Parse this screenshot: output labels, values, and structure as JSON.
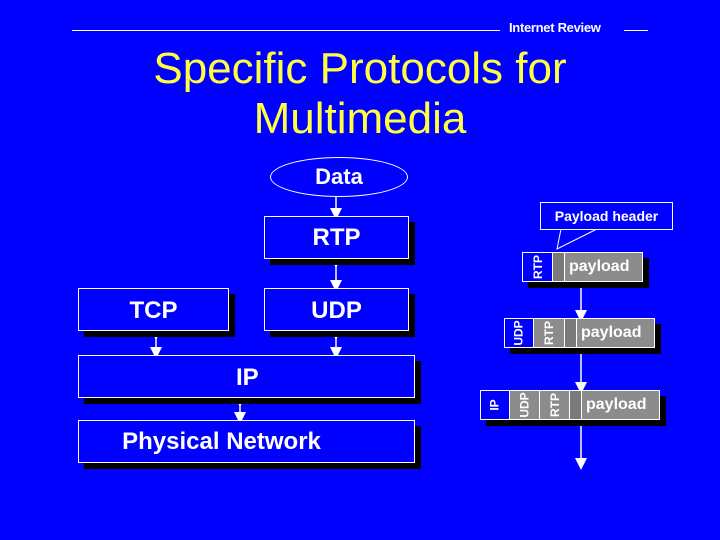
{
  "header": {
    "label": "Internet Review"
  },
  "title": {
    "line1": "Specific Protocols for",
    "line2": "Multimedia"
  },
  "stack": {
    "data": "Data",
    "rtp": "RTP",
    "tcp": "TCP",
    "udp": "UDP",
    "ip": "IP",
    "physical": "Physical Network"
  },
  "encapsulation": {
    "callout": "Payload header",
    "packets": [
      {
        "headers": [
          "RTP"
        ],
        "payload": "payload"
      },
      {
        "headers": [
          "UDP",
          "RTP"
        ],
        "payload": "payload"
      },
      {
        "headers": [
          "IP",
          "UDP",
          "RTP"
        ],
        "payload": "payload"
      }
    ]
  },
  "colors": {
    "background": "#0000ff",
    "title": "#ffff40",
    "lines": "#ffffff",
    "shadow": "#000000",
    "payload_fill": "#8c8c8c"
  }
}
